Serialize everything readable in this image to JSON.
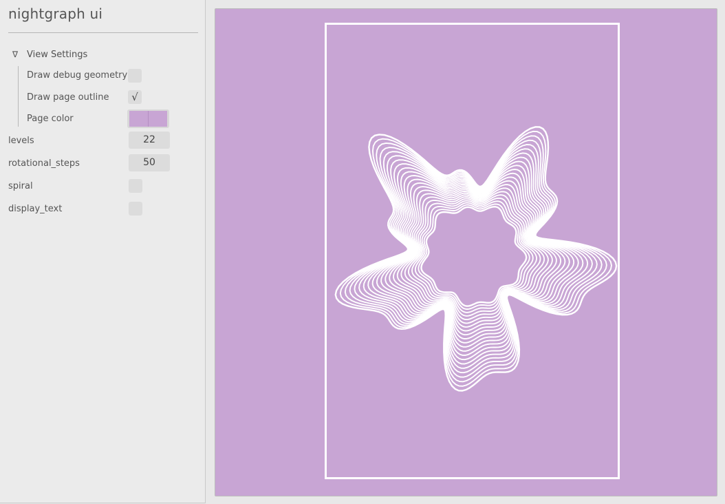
{
  "app": {
    "title": "nightgraph ui"
  },
  "view_settings": {
    "header": "View Settings",
    "expanded": true,
    "draw_debug_geometry": {
      "label": "Draw debug geometry",
      "checked": false
    },
    "draw_page_outline": {
      "label": "Draw page outline",
      "checked": true,
      "check_glyph": "√"
    },
    "page_color": {
      "label": "Page color",
      "value": "#c8a5d4"
    }
  },
  "params": {
    "levels": {
      "label": "levels",
      "value": "22"
    },
    "rotational_steps": {
      "label": "rotational_steps",
      "value": "50"
    },
    "spiral": {
      "label": "spiral",
      "checked": false
    },
    "display_text": {
      "label": "display_text",
      "checked": false
    }
  },
  "canvas": {
    "background": "#c8a5d4",
    "line_color": "#ffffff",
    "artwork": "wavy concentric rings"
  },
  "icons": {
    "tree_arrow": "triangle-down-icon",
    "checkmark": "checkmark-icon"
  }
}
